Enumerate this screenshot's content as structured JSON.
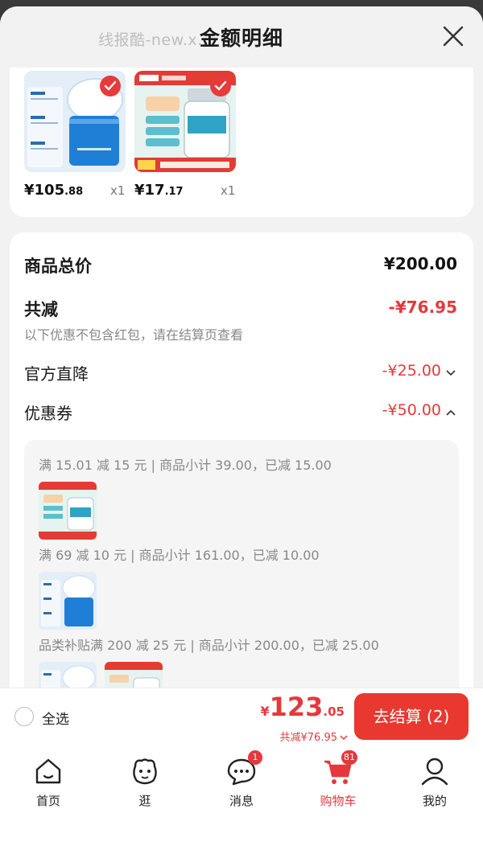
{
  "header": {
    "title": "金额明细",
    "watermark": "线报酷-new.x..."
  },
  "products": [
    {
      "price_int": "¥105",
      "price_dec": ".88",
      "qty": "x1"
    },
    {
      "price_int": "¥17",
      "price_dec": ".17",
      "qty": "x1"
    }
  ],
  "summary": {
    "goods_total_label": "商品总价",
    "goods_total_value": "¥200.00",
    "discount_label": "共减",
    "discount_value": "-¥76.95",
    "note": "以下优惠不包含红包，请在结算页查看",
    "official_label": "官方直降",
    "official_value": "-¥25.00",
    "coupon_label": "优惠券",
    "coupon_value": "-¥50.00"
  },
  "coupons": [
    {
      "text": "满 15.01 减 15 元 | 商品小计 39.00，已减 15.00"
    },
    {
      "text": "满 69 减 10 元 | 商品小计 161.00，已减 10.00"
    },
    {
      "text": "品类补贴满 200 减 25 元 | 商品小计 200.00，已减 25.00"
    }
  ],
  "bottom_bar": {
    "select_all": "全选",
    "currency": "¥",
    "total_int": "123",
    "total_dec": ".05",
    "saved": "共减¥76.95",
    "checkout": "去结算 (2)"
  },
  "tabs": [
    {
      "label": "首页"
    },
    {
      "label": "逛"
    },
    {
      "label": "消息",
      "badge": "1"
    },
    {
      "label": "购物车",
      "badge": "81"
    },
    {
      "label": "我的"
    }
  ],
  "colors": {
    "accent": "#e4393c",
    "checkout_bg": "#e8382f"
  }
}
